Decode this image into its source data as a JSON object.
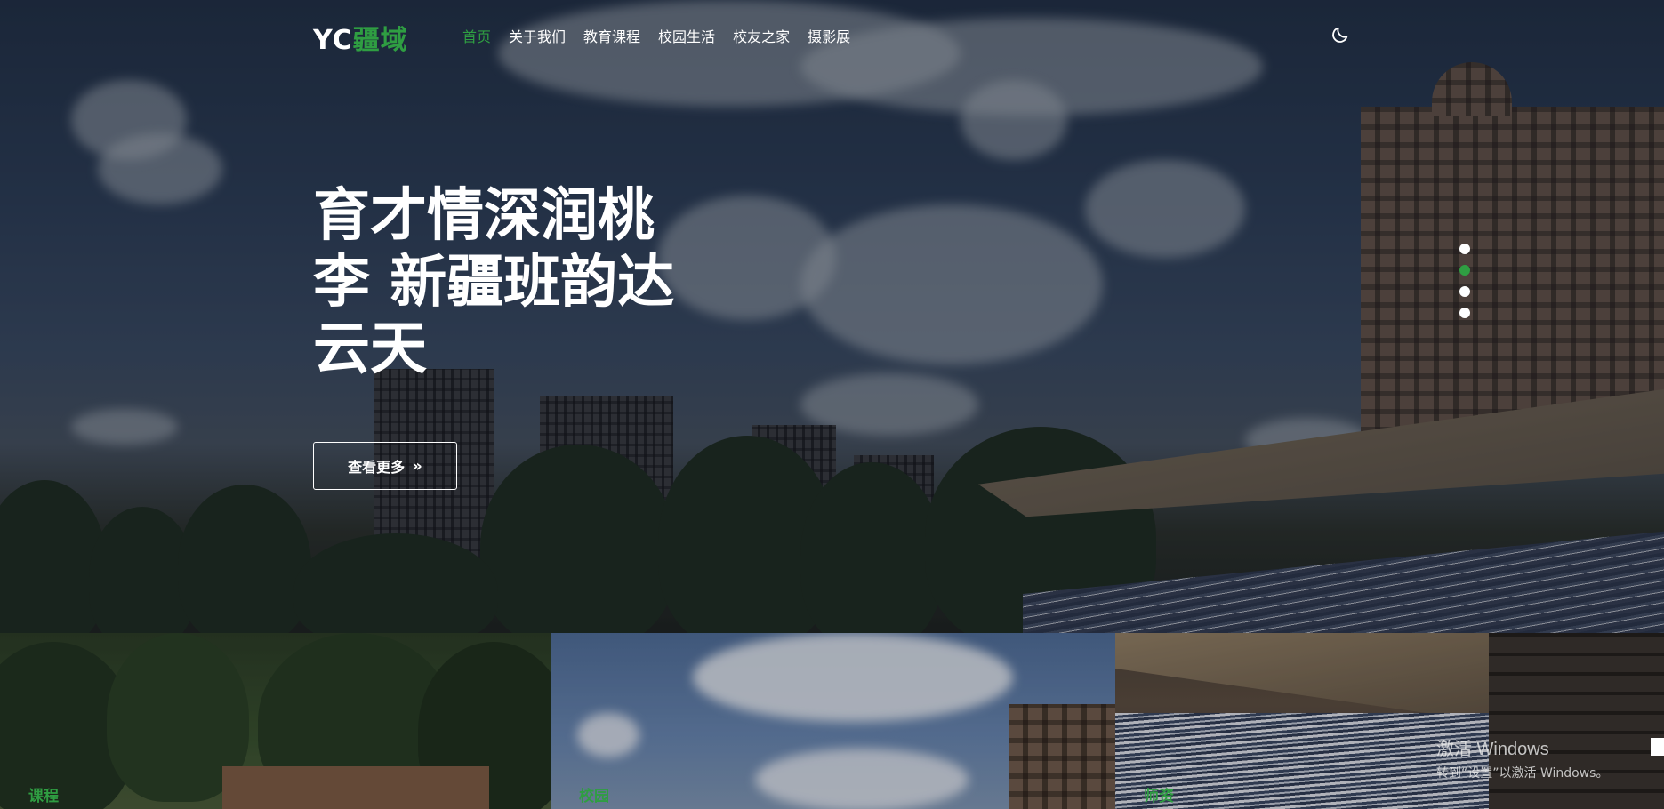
{
  "logo": {
    "prefix": "YC",
    "accent": "疆域"
  },
  "nav": {
    "items": [
      {
        "label": "首页",
        "active": true
      },
      {
        "label": "关于我们",
        "active": false
      },
      {
        "label": "教育课程",
        "active": false
      },
      {
        "label": "校园生活",
        "active": false
      },
      {
        "label": "校友之家",
        "active": false
      },
      {
        "label": "摄影展",
        "active": false
      }
    ],
    "theme_icon": "moon-icon"
  },
  "hero": {
    "title": "育才情深润桃李 新疆班韵达云天",
    "button_label": "查看更多",
    "button_icon": "double-chevron-right-icon",
    "slides": 4,
    "active_slide": 2
  },
  "cards": [
    {
      "label": "课程"
    },
    {
      "label": "校园"
    },
    {
      "label": "师资"
    }
  ],
  "watermark": {
    "line1": "激活 Windows",
    "line2": "转到“设置”以激活 Windows。"
  },
  "colors": {
    "accent": "#2f9e42",
    "text": "#ffffff"
  }
}
